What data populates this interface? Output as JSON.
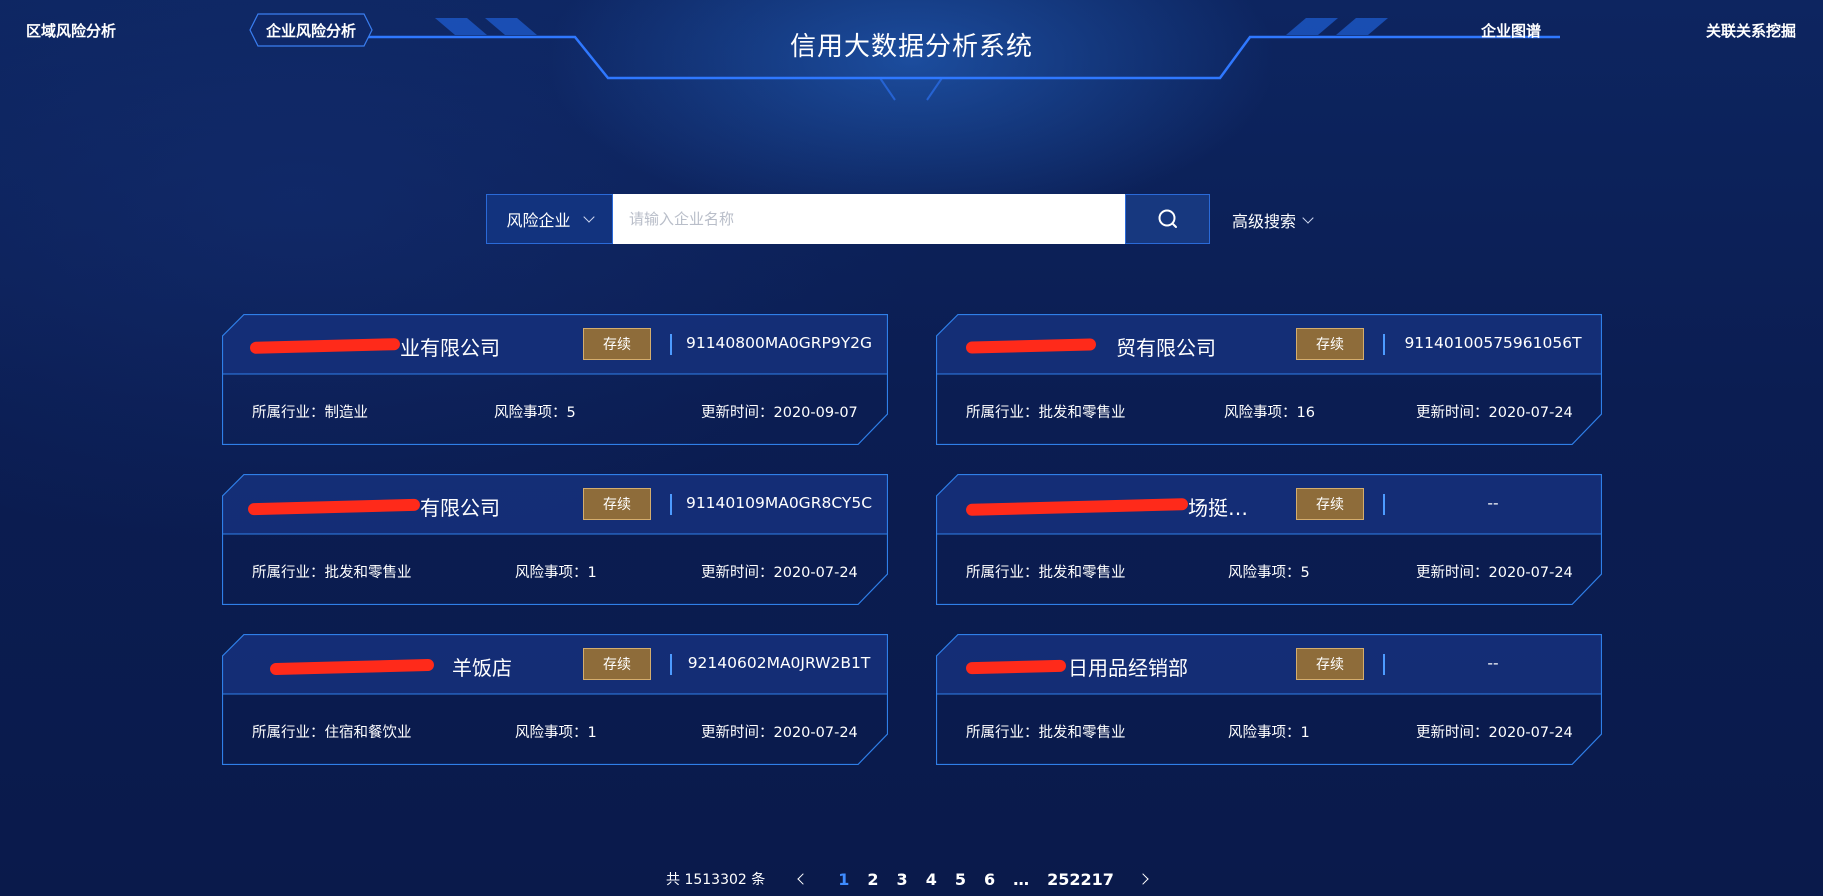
{
  "header": {
    "title": "信用大数据分析系统",
    "nav": [
      {
        "label": "区域风险分析"
      },
      {
        "label": "企业风险分析",
        "active": true
      },
      {
        "label": "企业图谱"
      },
      {
        "label": "关联关系挖掘"
      }
    ]
  },
  "search": {
    "type_selected": "风险企业",
    "placeholder": "请输入企业名称",
    "advanced_label": "高级搜索"
  },
  "cards": [
    {
      "name": "业有限公司",
      "status": "存续",
      "code": "91140800MA0GRP9Y2G",
      "industry": "所属行业：制造业",
      "risk": "风险事项：5",
      "updated": "更新时间：2020-09-07"
    },
    {
      "name": "贸有限公司",
      "status": "存续",
      "code": "91140100575961056T",
      "industry": "所属行业：批发和零售业",
      "risk": "风险事项：16",
      "updated": "更新时间：2020-07-24"
    },
    {
      "name": "有限公司",
      "status": "存续",
      "code": "91140109MA0GR8CY5C",
      "industry": "所属行业：批发和零售业",
      "risk": "风险事项：1",
      "updated": "更新时间：2020-07-24"
    },
    {
      "name": "场挺美内…",
      "status": "存续",
      "code": "--",
      "industry": "所属行业：批发和零售业",
      "risk": "风险事项：5",
      "updated": "更新时间：2020-07-24"
    },
    {
      "name": "羊饭店",
      "status": "存续",
      "code": "92140602MA0JRW2B1T",
      "industry": "所属行业：住宿和餐饮业",
      "risk": "风险事项：1",
      "updated": "更新时间：2020-07-24"
    },
    {
      "name": "日用品经销部",
      "status": "存续",
      "code": "--",
      "industry": "所属行业：批发和零售业",
      "risk": "风险事项：1",
      "updated": "更新时间：2020-07-24"
    }
  ],
  "pagination": {
    "total_label": "共 1513302 条",
    "pages": [
      "1",
      "2",
      "3",
      "4",
      "5",
      "6"
    ],
    "ellipsis": "…",
    "last_page": "252217",
    "current": "1"
  },
  "colors": {
    "background": "#0b1d52",
    "card_header": "#15307a",
    "card_border": "#2f7fe8",
    "status_badge": "#8e6c3a",
    "accent": "#3f8cff",
    "redaction": "#ff2a1a"
  }
}
